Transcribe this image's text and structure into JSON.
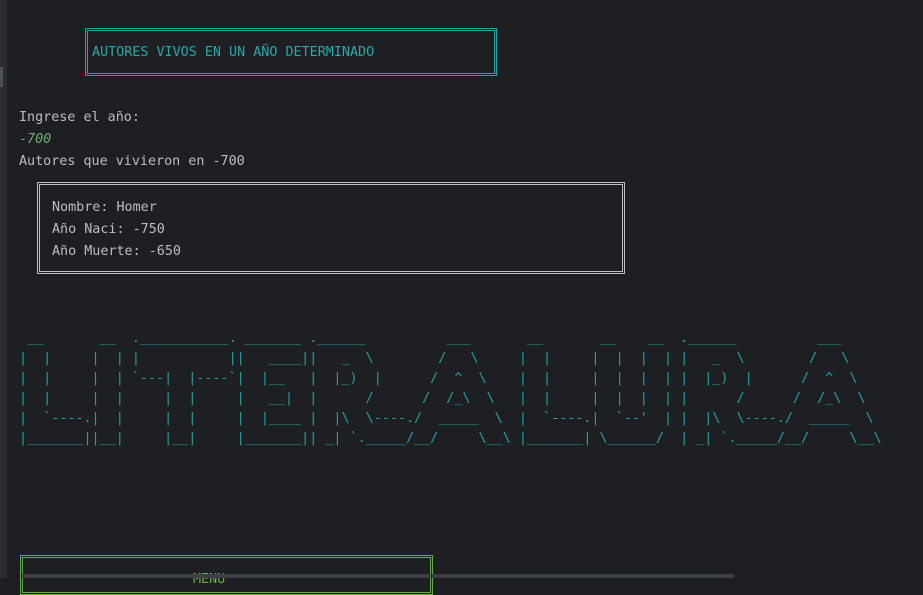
{
  "header": {
    "title": "AUTORES VIVOS EN UN AÑO DETERMINADO"
  },
  "prompt": {
    "label": "Ingrese el año:",
    "input_value": "-700"
  },
  "result": {
    "summary": "Autores que vivieron en -700",
    "author": {
      "name": "Nombre: Homer",
      "birth": "Año Naci: -750",
      "death": "Año Muerte: -650"
    }
  },
  "logo": {
    "text": " __       __  .___________. _______ .______          ___       __       __    __  .______          ___  \n|  |     |  | |           ||   ____||   _  \\        /   \\     |  |     |  |  |  | |   _  \\        /   \\ \n|  |     |  | `---|  |----`|  |__   |  |_)  |      /  ^  \\    |  |     |  |  |  | |  |_)  |      /  ^  \\\n|  |     |  |     |  |     |   __|  |      /      /  /_\\  \\   |  |     |  |  |  | |      /      /  /_\\  \\\n|  `----.|  |     |  |     |  |____ |  |\\  \\----./  _____  \\  |  `----.|  `--'  | |  |\\  \\----./  _____  \\\n|_______||__|     |__|     |_______|| _| `._____/__/     \\__\\ |_______| \\______/  | _| `._____/__/     \\__\\"
  },
  "menu": {
    "title": "MENU"
  },
  "colors": {
    "background": "#1e1f22",
    "text": "#bcbec4",
    "cyan": "#20a7a7",
    "green": "#6aab73",
    "menu_border": "#6aab40"
  }
}
